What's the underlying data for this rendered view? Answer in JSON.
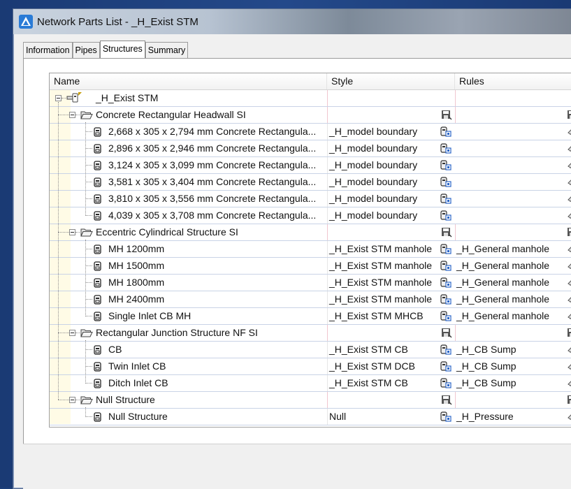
{
  "window": {
    "title": "Network Parts List - _H_Exist STM"
  },
  "tabs": [
    {
      "label": "Information",
      "active": false
    },
    {
      "label": "Pipes",
      "active": false
    },
    {
      "label": "Structures",
      "active": true
    },
    {
      "label": "Summary",
      "active": false
    }
  ],
  "grid": {
    "columns": {
      "name": "Name",
      "style": "Style",
      "rules": "Rules"
    },
    "root": {
      "label": "_H_Exist STM"
    },
    "groups": [
      {
        "label": "Concrete Rectangular Headwall SI",
        "items": [
          {
            "name": "2,668 x 305 x 2,794 mm Concrete Rectangula...",
            "style": "_H_model boundary",
            "rules": ""
          },
          {
            "name": "2,896 x 305 x 2,946 mm Concrete Rectangula...",
            "style": "_H_model boundary",
            "rules": ""
          },
          {
            "name": "3,124 x 305 x 3,099 mm Concrete Rectangula...",
            "style": "_H_model boundary",
            "rules": ""
          },
          {
            "name": "3,581 x 305 x 3,404 mm Concrete Rectangula...",
            "style": "_H_model boundary",
            "rules": ""
          },
          {
            "name": "3,810 x 305 x 3,556 mm Concrete Rectangula...",
            "style": "_H_model boundary",
            "rules": ""
          },
          {
            "name": "4,039 x 305 x 3,708 mm Concrete Rectangula...",
            "style": "_H_model boundary",
            "rules": ""
          }
        ]
      },
      {
        "label": "Eccentric Cylindrical Structure SI",
        "items": [
          {
            "name": "MH 1200mm",
            "style": "_H_Exist STM manhole",
            "rules": "_H_General manhole"
          },
          {
            "name": "MH 1500mm",
            "style": "_H_Exist STM manhole",
            "rules": "_H_General manhole"
          },
          {
            "name": "MH 1800mm",
            "style": "_H_Exist STM manhole",
            "rules": "_H_General manhole"
          },
          {
            "name": "MH 2400mm",
            "style": "_H_Exist STM manhole",
            "rules": "_H_General manhole"
          },
          {
            "name": "Single Inlet CB MH",
            "style": "_H_Exist STM MHCB",
            "rules": "_H_General manhole"
          }
        ]
      },
      {
        "label": "Rectangular Junction Structure NF SI",
        "items": [
          {
            "name": "CB",
            "style": "_H_Exist STM CB",
            "rules": "_H_CB Sump"
          },
          {
            "name": "Twin Inlet CB",
            "style": "_H_Exist STM DCB",
            "rules": "_H_CB Sump"
          },
          {
            "name": "Ditch Inlet CB",
            "style": "_H_Exist STM CB",
            "rules": "_H_CB Sump"
          }
        ]
      },
      {
        "label": "Null Structure",
        "items": [
          {
            "name": "Null Structure",
            "style": "Null",
            "rules": "_H_Pressure"
          }
        ]
      }
    ]
  },
  "colors": {
    "desktop": "#1d3f7a",
    "tree_shade": "#fffbe6",
    "row_border": "#c9d3e6"
  },
  "icons": {
    "app": "civil3d-app-icon",
    "root": "pipe-network-icon",
    "group": "open-folder-icon",
    "item": "structure-part-icon",
    "group_style": "save-disk-icon",
    "item_style": "style-picker-icon",
    "rules": "rules-icon"
  }
}
